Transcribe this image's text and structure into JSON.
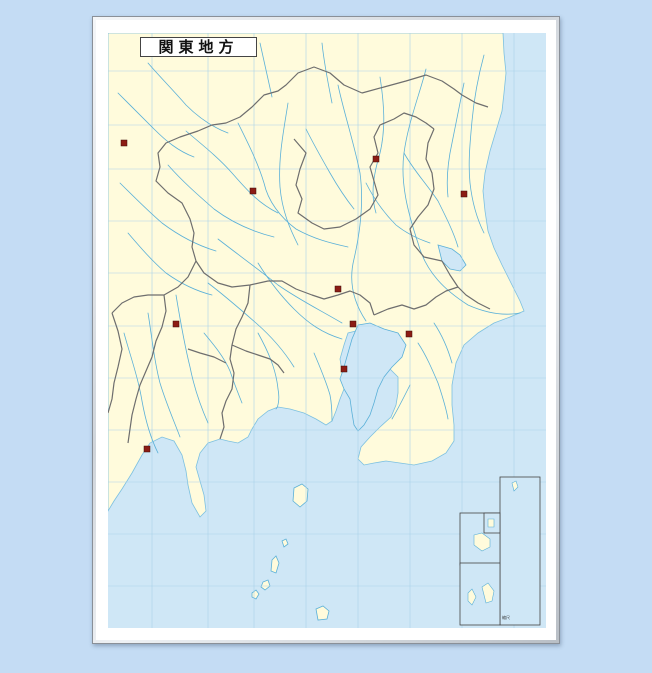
{
  "map": {
    "title": "関東地方",
    "scale_label": "縮尺",
    "colors": {
      "page_background": "#c4dcf4",
      "sea": "#cfe7f6",
      "land": "#fffbdc",
      "river": "#5ab0d8",
      "grid": "#a9d2ea",
      "prefecture_border": "#6e6e6e",
      "city_marker": "#8c1c14"
    },
    "city_markers": [
      "prefectural-capital",
      "prefectural-capital",
      "prefectural-capital",
      "prefectural-capital",
      "prefectural-capital",
      "prefectural-capital",
      "prefectural-capital",
      "prefectural-capital",
      "prefectural-capital",
      "prefectural-capital"
    ],
    "inset_maps": [
      "outlying-island-inset-1",
      "outlying-island-inset-2",
      "outlying-island-inset-3",
      "outlying-island-inset-4"
    ]
  }
}
